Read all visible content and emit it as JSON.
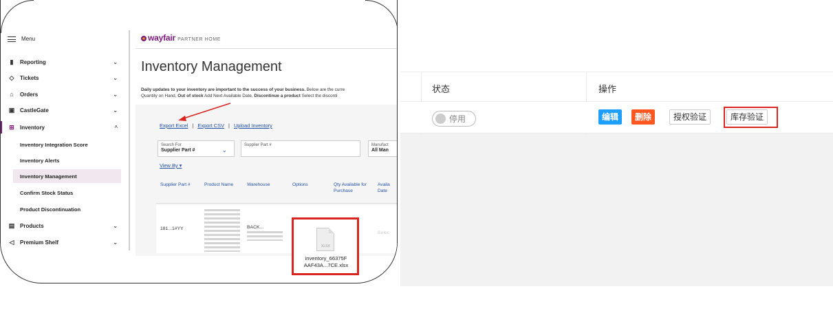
{
  "left_screenshot": {
    "sidebar": {
      "menu_label": "Menu",
      "items": [
        {
          "label": "Reporting",
          "chevron": "⌄"
        },
        {
          "label": "Tickets",
          "chevron": "⌄"
        },
        {
          "label": "Orders",
          "chevron": "⌄"
        },
        {
          "label": "CastleGate",
          "chevron": "⌄"
        },
        {
          "label": "Inventory",
          "chevron": "^"
        }
      ],
      "sub_items": [
        {
          "label": "Inventory Integration Score"
        },
        {
          "label": "Inventory Alerts"
        },
        {
          "label": "Inventory Management"
        },
        {
          "label": "Confirm Stock Status"
        },
        {
          "label": "Product Discontinuation"
        }
      ],
      "bottom_items": [
        {
          "label": "Products",
          "chevron": "⌄"
        },
        {
          "label": "Premium Shelf",
          "chevron": "⌄"
        }
      ]
    },
    "header": {
      "brand": "wayfair",
      "brand_suffix": "PARTNER HOME"
    },
    "page_title": "Inventory Management",
    "description_line1_a": "Daily updates to your inventory are important to the success of your business.",
    "description_line1_b": " Below are the curre",
    "description_line2_a": "Quantity on Hand, ",
    "description_line2_b": "Out of stock",
    "description_line2_c": " Add Next Available Date, ",
    "description_line2_d": "Discontinue a product",
    "description_line2_e": " Select the disconti",
    "links": {
      "export_excel": "Export Excel",
      "export_csv": "Export CSV",
      "upload_inventory": "Upload Inventory",
      "separator": "|"
    },
    "filters": {
      "search_for_label": "Search For",
      "search_for_value": "Supplier Part #",
      "supplier_part_label": "Supplier Part #",
      "manufacturer_label": "Manufact",
      "manufacturer_value": "All Man"
    },
    "view_by": "View By",
    "table": {
      "columns": [
        "Supplier Part #",
        "Product Name",
        "Warehouse",
        "Options",
        "Qty Available for Purchase",
        "Availa Date"
      ],
      "row1": {
        "supplier_part": "181...1#YY",
        "warehouse": "BACK...",
        "date_hint": "Selec"
      }
    },
    "download": {
      "file_ext": "XLSX",
      "file_name_line1": "inventory_66375F",
      "file_name_line2": "AAF43A...7CE.xlsx"
    }
  },
  "right_screenshot": {
    "columns": {
      "status": "状态",
      "actions": "操作"
    },
    "row": {
      "status_toggle": "停用",
      "edit_button": "编辑",
      "delete_button": "删除",
      "auth_verify_button": "授权验证",
      "stock_verify_button": "库存验证"
    }
  },
  "colors": {
    "wayfair_purple": "#7f187f",
    "highlight_red": "#d9241f",
    "edit_blue": "#1e9fff",
    "delete_orange": "#ff5722",
    "link_blue": "#1f4fa8"
  }
}
